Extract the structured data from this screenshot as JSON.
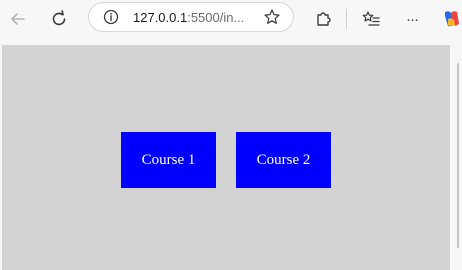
{
  "browser": {
    "address": {
      "host": "127.0.0.1",
      "rest": ":5500/in..."
    },
    "icons": {
      "back": "back-arrow-icon",
      "refresh": "refresh-icon",
      "info": "info-icon",
      "favorite": "star-icon",
      "extensions": "puzzle-icon",
      "favorites": "favorites-list-icon",
      "more": "more-icon",
      "copilot": "copilot-icon"
    },
    "more_glyph": "···"
  },
  "page": {
    "background": "#d3d3d3",
    "buttons": [
      {
        "label": "Course 1",
        "color": "#0000ff"
      },
      {
        "label": "Course 2",
        "color": "#0000ff"
      }
    ]
  }
}
